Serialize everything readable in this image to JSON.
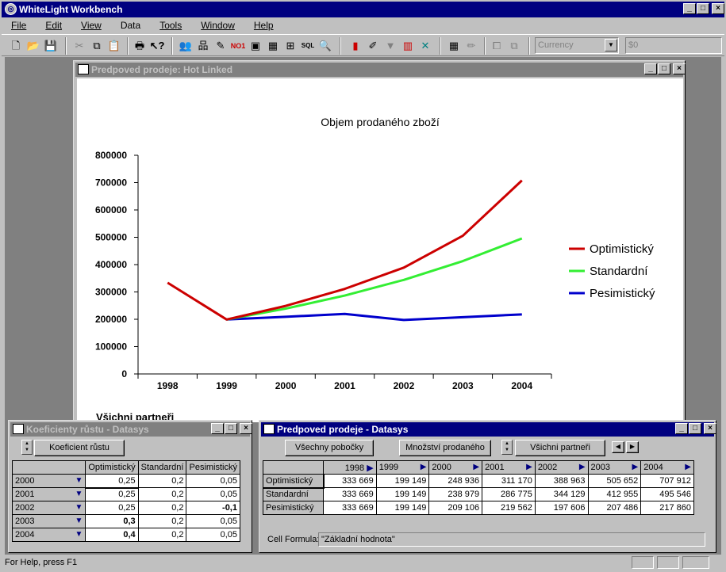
{
  "app": {
    "title": "WhiteLight Workbench",
    "menu": [
      "File",
      "Edit",
      "View",
      "Data",
      "Tools",
      "Window",
      "Help"
    ],
    "currency_combo": "Currency",
    "value_field": "$0",
    "status": "For Help, press F1"
  },
  "chart_window": {
    "title": "Predpoved prodeje: Hot Linked",
    "footer": "Všichni partneři"
  },
  "chart_data": {
    "type": "line",
    "title": "Objem prodaného zboží",
    "categories": [
      "1998",
      "1999",
      "2000",
      "2001",
      "2002",
      "2003",
      "2004"
    ],
    "ylim": [
      0,
      800000
    ],
    "yticks": [
      "0",
      "100000",
      "200000",
      "300000",
      "400000",
      "500000",
      "600000",
      "700000",
      "800000"
    ],
    "legend_position": "right",
    "series": [
      {
        "name": "Optimistický",
        "color": "#cc0000",
        "values": [
          333669,
          199149,
          248936,
          311170,
          388963,
          505652,
          707912
        ]
      },
      {
        "name": "Standardní",
        "color": "#33ee33",
        "values": [
          null,
          199149,
          238979,
          286775,
          344129,
          412955,
          495546
        ]
      },
      {
        "name": "Pesimistický",
        "color": "#0000cc",
        "values": [
          null,
          199149,
          209106,
          219562,
          197606,
          207486,
          217860
        ]
      }
    ]
  },
  "coef_window": {
    "title": "Koeficienty růstu - Datasys",
    "button": "Koeficient růstu",
    "columns": [
      "Optimistický",
      "Standardní",
      "Pesimistický"
    ],
    "rows": [
      {
        "year": "2000",
        "vals": [
          "0,25",
          "0,2",
          "0,05"
        ]
      },
      {
        "year": "2001",
        "vals": [
          "0,25",
          "0,2",
          "0,05"
        ]
      },
      {
        "year": "2002",
        "vals": [
          "0,25",
          "0,2",
          "-0,1"
        ]
      },
      {
        "year": "2003",
        "vals": [
          "0,3",
          "0,2",
          "0,05"
        ]
      },
      {
        "year": "2004",
        "vals": [
          "0,4",
          "0,2",
          "0,05"
        ]
      }
    ]
  },
  "data_window": {
    "title": "Predpoved prodeje - Datasys",
    "btn_branches": "Všechny pobočky",
    "btn_quantity": "Množství prodaného",
    "btn_partners": "Všichni partneři",
    "years": [
      "1998",
      "1999",
      "2000",
      "2001",
      "2002",
      "2003",
      "2004"
    ],
    "rows": [
      {
        "name": "Optimistický",
        "vals": [
          "333 669",
          "199 149",
          "248 936",
          "311 170",
          "388 963",
          "505 652",
          "707 912"
        ]
      },
      {
        "name": "Standardní",
        "vals": [
          "333 669",
          "199 149",
          "238 979",
          "286 775",
          "344 129",
          "412 955",
          "495 546"
        ]
      },
      {
        "name": "Pesimistický",
        "vals": [
          "333 669",
          "199 149",
          "209 106",
          "219 562",
          "197 606",
          "207 486",
          "217 860"
        ]
      }
    ],
    "cell_formula_label": "Cell Formula:",
    "cell_formula_value": "\"Základní hodnota\""
  }
}
